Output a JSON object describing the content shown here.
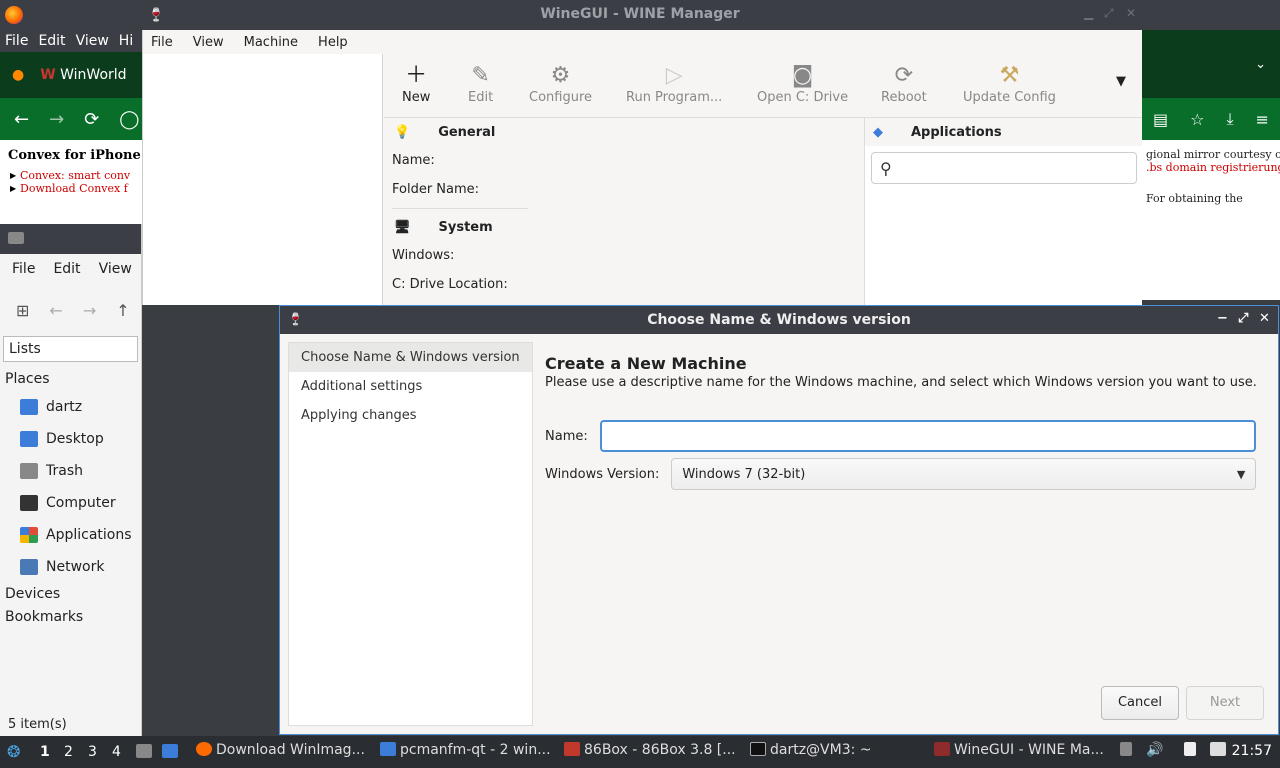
{
  "wine_titlebar": {
    "title": "WineGUI - WINE Manager"
  },
  "firefox": {
    "menu": [
      "File",
      "Edit",
      "View",
      "Hi"
    ],
    "tab_label": "WinWorld",
    "content_heading": "Convex for iPhone",
    "links": [
      "Convex: smart conv",
      "Download Convex f"
    ],
    "right_text": [
      "gional mirror courtesy of",
      ".bs domain registrierung",
      "For obtaining the"
    ]
  },
  "file_manager": {
    "menu": [
      "File",
      "Edit",
      "View"
    ],
    "lists_label": "Lists",
    "places_label": "Places",
    "places": [
      {
        "label": "dartz",
        "color": "#3b7dd8"
      },
      {
        "label": "Desktop",
        "color": "#3b7dd8"
      },
      {
        "label": "Trash",
        "color": "#888888"
      },
      {
        "label": "Computer",
        "color": "#333333"
      },
      {
        "label": "Applications",
        "color": "#e04e39"
      },
      {
        "label": "Network",
        "color": "#4a7ab5"
      }
    ],
    "devices_label": "Devices",
    "bookmarks_label": "Bookmarks",
    "status": "5 item(s)"
  },
  "winegui": {
    "menu": [
      "File",
      "View",
      "Machine",
      "Help"
    ],
    "toolbar": [
      "New",
      "Edit",
      "Configure",
      "Run Program...",
      "Open C: Drive",
      "Reboot",
      "Update Config"
    ],
    "general_label": "General",
    "name_label": "Name:",
    "folder_label": "Folder Name:",
    "system_label": "System",
    "windows_label": "Windows:",
    "cdrive_label": "C: Drive Location:",
    "apps_label": "Applications",
    "apps_search_placeholder": ""
  },
  "dialog": {
    "title": "Choose Name & Windows version",
    "steps": [
      "Choose Name & Windows version",
      "Additional settings",
      "Applying changes"
    ],
    "heading": "Create a New Machine",
    "description": "Please use a descriptive name for the Windows machine, and select which Windows version you want to use.",
    "name_label": "Name:",
    "name_value": "",
    "version_label": "Windows Version:",
    "version_value": "Windows 7 (32-bit)",
    "cancel_label": "Cancel",
    "next_label": "Next"
  },
  "taskbar": {
    "workspaces": [
      "1",
      "2",
      "3",
      "4"
    ],
    "tasks": [
      "Download WinImag...",
      "pcmanfm-qt - 2 win...",
      "86Box - 86Box 3.8 [...",
      "dartz@VM3: ~",
      "WineGUI - WINE Ma..."
    ],
    "clock": "21:57"
  }
}
